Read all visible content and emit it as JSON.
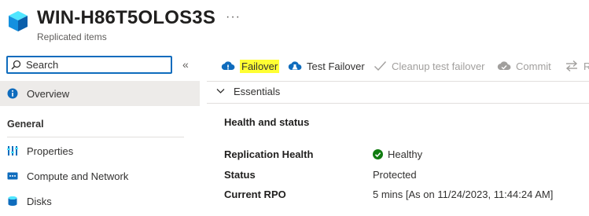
{
  "header": {
    "title": "WIN-H86T5OLOS3S",
    "subtitle": "Replicated items",
    "more_icon": "ellipsis-icon",
    "resource_icon": "cube-icon"
  },
  "sidebar": {
    "search": {
      "placeholder": "Search",
      "value": ""
    },
    "collapse_label": "«",
    "items": [
      {
        "label": "Overview",
        "icon": "info-icon",
        "selected": true
      }
    ],
    "sections": [
      {
        "label": "General",
        "items": [
          {
            "label": "Properties",
            "icon": "properties-icon"
          },
          {
            "label": "Compute and Network",
            "icon": "network-icon"
          },
          {
            "label": "Disks",
            "icon": "disks-icon"
          }
        ]
      }
    ]
  },
  "toolbar": {
    "buttons": [
      {
        "label": "Failover",
        "icon": "failover-icon",
        "highlighted": true,
        "enabled": true
      },
      {
        "label": "Test Failover",
        "icon": "test-failover-icon",
        "enabled": true
      },
      {
        "label": "Cleanup test failover",
        "icon": "checkmark-icon",
        "enabled": false
      },
      {
        "label": "Commit",
        "icon": "commit-icon",
        "enabled": false
      },
      {
        "label": "R",
        "icon": "switch-arrows-icon",
        "enabled": false
      }
    ]
  },
  "essentials": {
    "label": "Essentials"
  },
  "health": {
    "title": "Health and status",
    "properties": [
      {
        "label": "Replication Health",
        "value": "Healthy",
        "status_icon": "check-circle-icon"
      },
      {
        "label": "Status",
        "value": "Protected"
      },
      {
        "label": "Current RPO",
        "value": "5 mins [As on 11/24/2023, 11:44:24 AM]"
      }
    ]
  },
  "colors": {
    "accent": "#0f6cbd",
    "highlight": "#ffff33",
    "success": "#107c10",
    "selected_bg": "#edebe9"
  }
}
